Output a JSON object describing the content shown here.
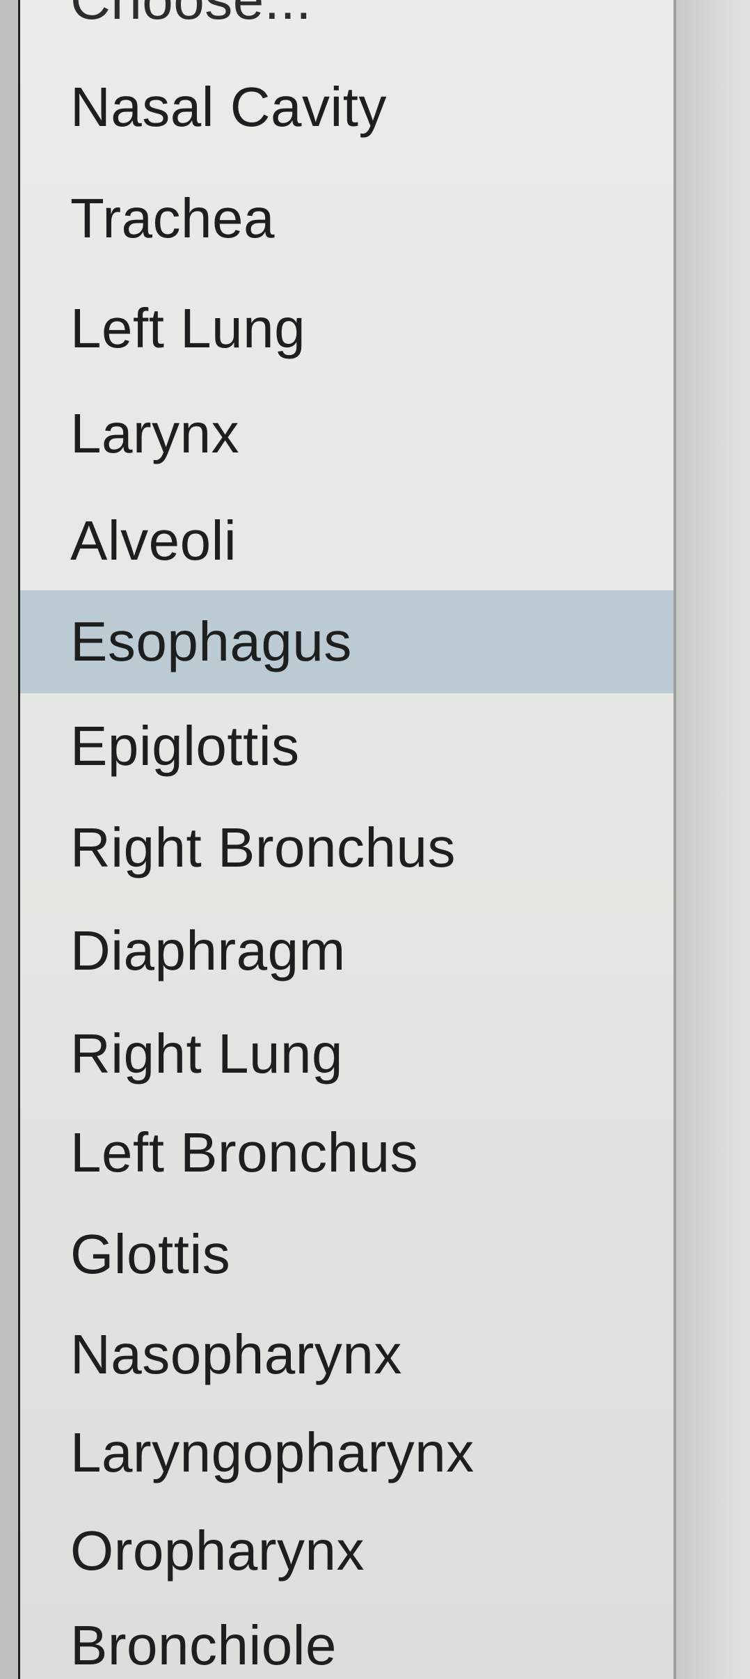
{
  "dropdown": {
    "placeholder": "Choose...",
    "highlighted_index": 5,
    "options": [
      "Nasal Cavity",
      "Trachea",
      "Left Lung",
      "Larynx",
      "Alveoli",
      "Esophagus",
      "Epiglottis",
      "Right Bronchus",
      "Diaphragm",
      "Right Lung",
      "Left Bronchus",
      "Glottis",
      "Nasopharynx",
      "Laryngopharynx",
      "Oropharynx",
      "Bronchiole"
    ]
  },
  "colors": {
    "highlight": "#bccbd3",
    "text": "#1d1f1f"
  }
}
